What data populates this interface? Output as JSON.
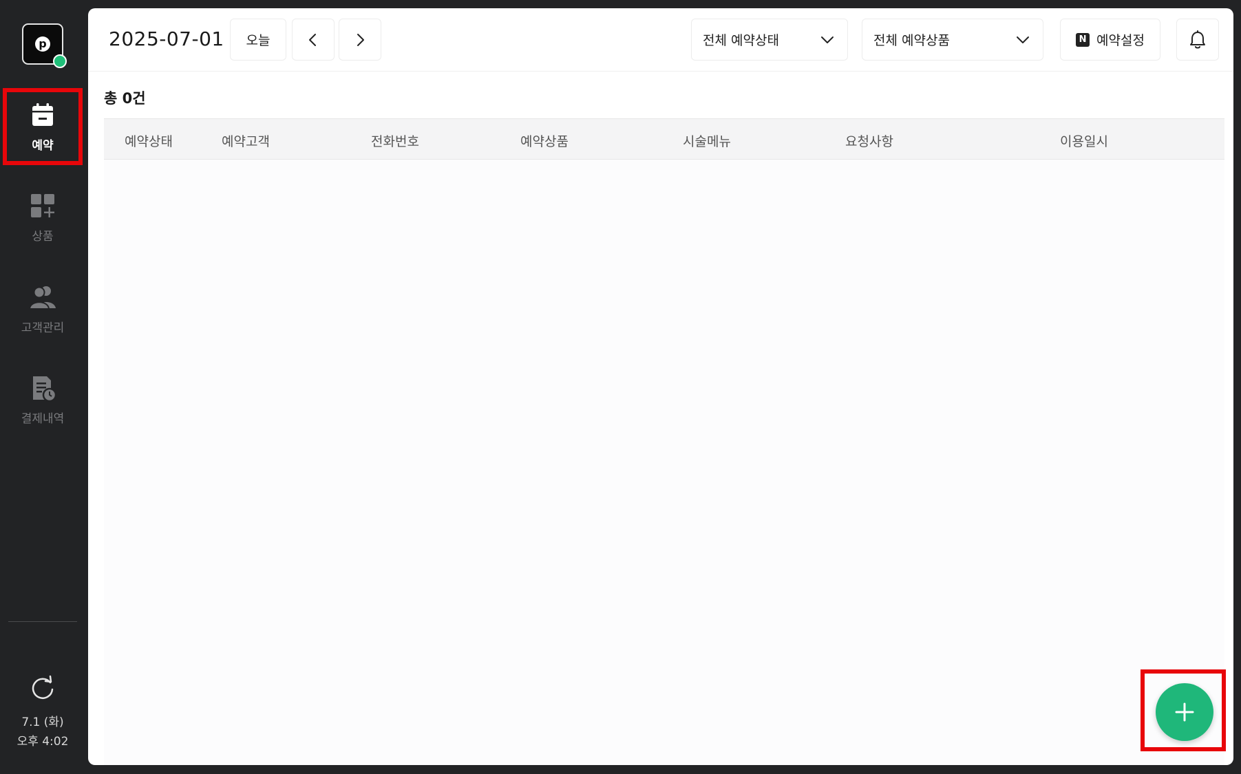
{
  "app": {
    "logo_letter": "p"
  },
  "sidebar": {
    "items": [
      {
        "label": "예약",
        "icon": "calendar-icon",
        "active": true
      },
      {
        "label": "상품",
        "icon": "product-grid-add-icon",
        "active": false
      },
      {
        "label": "고객관리",
        "icon": "customers-icon",
        "active": false
      },
      {
        "label": "결제내역",
        "icon": "payment-history-icon",
        "active": false
      }
    ],
    "refresh_icon": "refresh-icon",
    "date_line": "7.1 (화)",
    "time_line": "오후 4:02"
  },
  "toolbar": {
    "date": "2025-07-01",
    "today_label": "오늘",
    "prev_icon": "chevron-left-icon",
    "next_icon": "chevron-right-icon",
    "status_filter": "전체 예약상태",
    "product_filter": "전체 예약상품",
    "settings_label": "예약설정",
    "settings_badge": "N",
    "bell_icon": "bell-icon"
  },
  "list": {
    "total_label": "총 0건",
    "columns": [
      "예약상태",
      "예약고객",
      "전화번호",
      "예약상품",
      "시술메뉴",
      "요청사항",
      "이용일시"
    ],
    "rows": []
  },
  "fab": {
    "icon": "plus-icon"
  },
  "colors": {
    "sidebar_bg": "#222325",
    "accent_green": "#1fb77a",
    "highlight_red": "#e8060a",
    "header_bg": "#f4f4f5"
  }
}
